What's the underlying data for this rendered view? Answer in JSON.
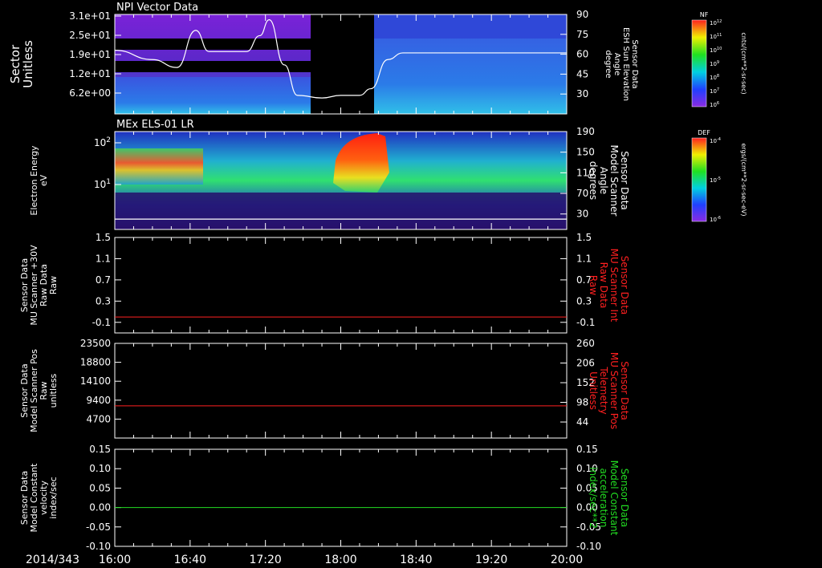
{
  "colors": {
    "background": "#000000",
    "axis": "#ffffff",
    "red_line": "#ff2020",
    "green_line": "#22dd22",
    "red_label": "#ff2020",
    "green_label": "#22dd22"
  },
  "footer": {
    "date": "2014/343",
    "time_ticks": [
      "16:00",
      "16:40",
      "17:20",
      "18:00",
      "18:40",
      "19:20",
      "20:00"
    ]
  },
  "colorbars": [
    {
      "title": "NF",
      "unit": "cnts/(cm**2-sr-sec)",
      "tick_labels": [
        "10^12",
        "10^11",
        "10^10",
        "10^9",
        "10^8",
        "10^7",
        "10^6"
      ]
    },
    {
      "title": "DEF",
      "unit": "ergs/(cm**2-sr-sec-eV)",
      "tick_labels": [
        "10^-4",
        "10^-5",
        "10^-6"
      ]
    }
  ],
  "chart_data": [
    {
      "type": "heatmap",
      "title": "NPI Vector Data",
      "ylabel": [
        "Sector",
        "Unitless"
      ],
      "y_ticks": [
        "3.1e+01",
        "2.5e+01",
        "1.9e+01",
        "1.2e+01",
        "6.2e+00"
      ],
      "right_ylabel": [
        "Sensor Data",
        "ESH Sun Elevation",
        "Angle",
        "degree"
      ],
      "right_ticks": [
        "90",
        "75",
        "60",
        "45",
        "30"
      ],
      "right_ylim": [
        15,
        90
      ],
      "data_gap": [
        "17:37",
        "18:16"
      ],
      "overlay_line": {
        "name": "ESH Sun Elevation Angle",
        "x": [
          "16:00",
          "16:20",
          "16:33",
          "16:43",
          "16:50",
          "17:10",
          "17:17",
          "17:22",
          "17:30",
          "17:37",
          "17:50",
          "18:00",
          "18:10",
          "18:16",
          "18:25",
          "18:33",
          "19:00",
          "20:00"
        ],
        "y": [
          63,
          56,
          50,
          78,
          62,
          62,
          74,
          86,
          52,
          29,
          27,
          29,
          29,
          34,
          56,
          61,
          61,
          61
        ]
      }
    },
    {
      "type": "heatmap",
      "title": "MEx ELS-01 LR",
      "ylabel": [
        "Electron Energy",
        "eV"
      ],
      "y_ticks": [
        "10^2",
        "10^1"
      ],
      "right_ylabel": [
        "Sensor Data",
        "Model Scanner",
        "Angle",
        "degrees"
      ],
      "right_ticks": [
        "190",
        "150",
        "110",
        "70",
        "30"
      ],
      "right_ylim": [
        0,
        190
      ],
      "overlay_line": {
        "name": "Model Scanner Angle",
        "x": [
          "16:00",
          "20:00"
        ],
        "y": [
          20,
          20
        ]
      }
    },
    {
      "type": "line",
      "ylabel": [
        "Sensor Data",
        "MU Scanner +30V",
        "Raw Data",
        "Raw"
      ],
      "y_ticks": [
        "1.5",
        "1.1",
        "0.7",
        "0.3",
        "-0.1"
      ],
      "ylim": [
        -0.3,
        1.5
      ],
      "right_ylabel": [
        "Sensor Data",
        "MU Scanner Int",
        "Raw Data",
        "Raw"
      ],
      "right_ticks": [
        "1.5",
        "1.1",
        "0.7",
        "0.3",
        "-0.1"
      ],
      "right_ylim": [
        -0.3,
        1.5
      ],
      "series": [
        {
          "color": "#ff2020",
          "axis": "left",
          "x": [
            "16:00",
            "20:00"
          ],
          "y": [
            0.0,
            0.0
          ]
        }
      ]
    },
    {
      "type": "line",
      "ylabel": [
        "Sensor Data",
        "Model Scanner Pos",
        "Raw",
        "unitless"
      ],
      "y_ticks": [
        "23500",
        "18800",
        "14100",
        "9400",
        "4700"
      ],
      "ylim": [
        0,
        23500
      ],
      "right_ylabel": [
        "Sensor Data",
        "MU Scanner Pos",
        "Telemetry",
        "Unitless"
      ],
      "right_ticks": [
        "260",
        "206",
        "152",
        "98",
        "44"
      ],
      "right_ylim": [
        0,
        260
      ],
      "series": [
        {
          "color": "#ff2020",
          "axis": "left",
          "x": [
            "16:00",
            "20:00"
          ],
          "y": [
            8000,
            8000
          ]
        }
      ]
    },
    {
      "type": "line",
      "ylabel": [
        "Sensor Data",
        "Model Constant",
        "velocity",
        "index/sec"
      ],
      "y_ticks": [
        "0.15",
        "0.10",
        "0.05",
        "0.00",
        "-0.05",
        "-0.10"
      ],
      "ylim": [
        -0.1,
        0.15
      ],
      "right_ylabel": [
        "Sensor Data",
        "Model Constant",
        "acceleration",
        "index/sec**2"
      ],
      "right_ticks": [
        "0.15",
        "0.10",
        "0.05",
        "0.00",
        "-0.05",
        "-0.10"
      ],
      "right_ylim": [
        -0.1,
        0.15
      ],
      "series": [
        {
          "color": "#22dd22",
          "axis": "left",
          "x": [
            "16:00",
            "20:00"
          ],
          "y": [
            0.0,
            0.0
          ]
        }
      ]
    }
  ]
}
